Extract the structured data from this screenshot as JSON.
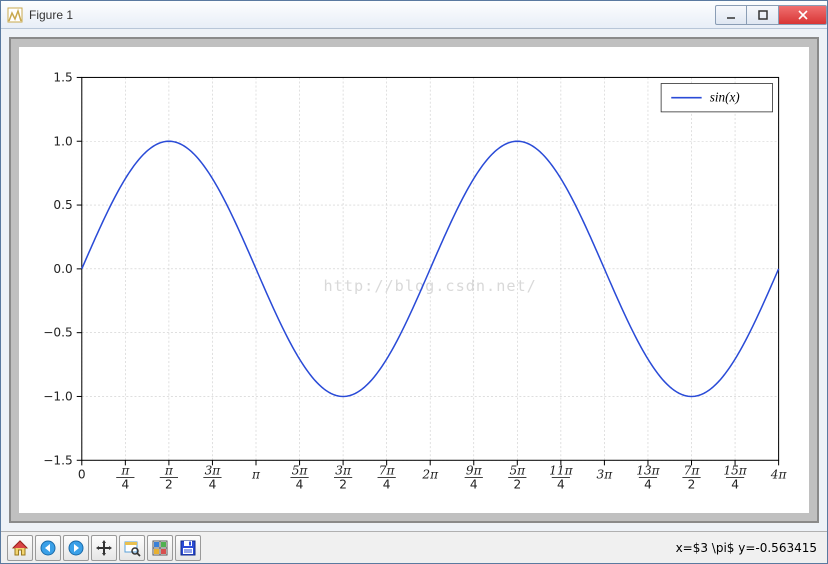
{
  "window": {
    "title": "Figure 1"
  },
  "chart_data": {
    "type": "line",
    "title": "",
    "xlabel": "",
    "ylabel": "",
    "xlim_pi": [
      0,
      4
    ],
    "ylim": [
      -1.5,
      1.5
    ],
    "xticks_label": [
      "0",
      "π/4",
      "π/2",
      "3π/4",
      "π",
      "5π/4",
      "3π/2",
      "7π/4",
      "2π",
      "9π/4",
      "5π/2",
      "11π/4",
      "3π",
      "13π/4",
      "7π/2",
      "15π/4",
      "4π"
    ],
    "xticks_pi": [
      0,
      0.25,
      0.5,
      0.75,
      1,
      1.25,
      1.5,
      1.75,
      2,
      2.25,
      2.5,
      2.75,
      3,
      3.25,
      3.5,
      3.75,
      4
    ],
    "yticks": [
      -1.5,
      -1.0,
      -0.5,
      0.0,
      0.5,
      1.0,
      1.5
    ],
    "series": [
      {
        "name": "sin(x)",
        "color": "#2a4bd7",
        "function": "sin",
        "domain_pi": [
          0,
          4
        ]
      }
    ],
    "grid": true,
    "legend_position": "upper right",
    "watermark": "http://blog.csdn.net/"
  },
  "toolbar": {
    "buttons": [
      {
        "name": "home-icon",
        "label": "Home"
      },
      {
        "name": "back-icon",
        "label": "Back"
      },
      {
        "name": "forward-icon",
        "label": "Forward"
      },
      {
        "name": "pan-icon",
        "label": "Pan"
      },
      {
        "name": "zoom-icon",
        "label": "Zoom"
      },
      {
        "name": "subplots-icon",
        "label": "Configure subplots"
      },
      {
        "name": "save-icon",
        "label": "Save"
      }
    ]
  },
  "status": {
    "text": "x=$3 \\pi$ y=-0.563415"
  }
}
